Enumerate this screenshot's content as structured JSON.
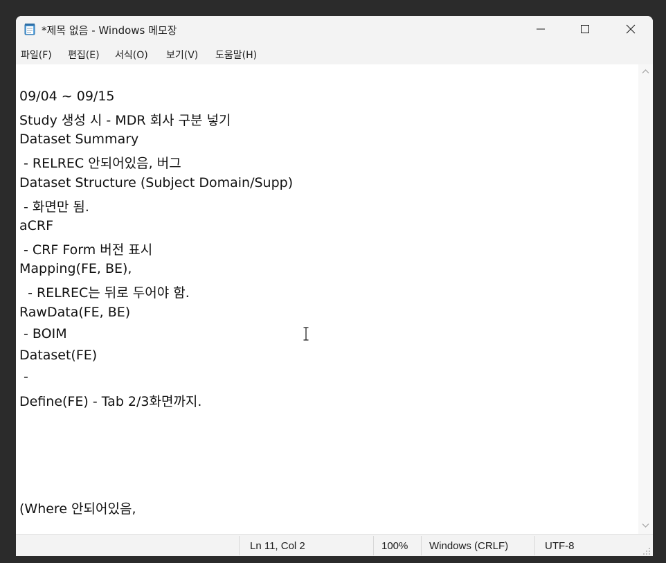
{
  "window": {
    "title": "*제목 없음 - Windows 메모장"
  },
  "menu": [
    {
      "label": "파일(F)"
    },
    {
      "label": "편집(E)"
    },
    {
      "label": "서식(O)"
    },
    {
      "label": "보기(V)"
    },
    {
      "label": "도움말(H)"
    }
  ],
  "editor": {
    "lines": [
      "",
      "09/04 ~ 09/15",
      "Study 생성 시 - MDR 회사 구분 넣기",
      "Dataset Summary",
      " - RELREC 안되어있음, 버그",
      "Dataset Structure (Subject Domain/Supp)",
      " - 화면만 됨.",
      "aCRF",
      " - CRF Form 버전 표시",
      "Mapping(FE, BE),",
      "  - RELREC는 뒤로 두어야 함.",
      "RawData(FE, BE)",
      " - BOIM",
      "Dataset(FE)",
      " -",
      "Define(FE) - Tab 2/3화면까지.",
      "",
      "",
      "",
      "",
      "(Where 안되어있음,"
    ]
  },
  "statusbar": {
    "position": "Ln 11, Col 2",
    "zoom": "100%",
    "line_ending": "Windows (CRLF)",
    "encoding": "UTF-8"
  },
  "icons": {
    "app": "notepad-icon",
    "minimize": "minimize-icon",
    "maximize": "maximize-icon",
    "close": "close-icon",
    "caret": "text-cursor-icon"
  }
}
